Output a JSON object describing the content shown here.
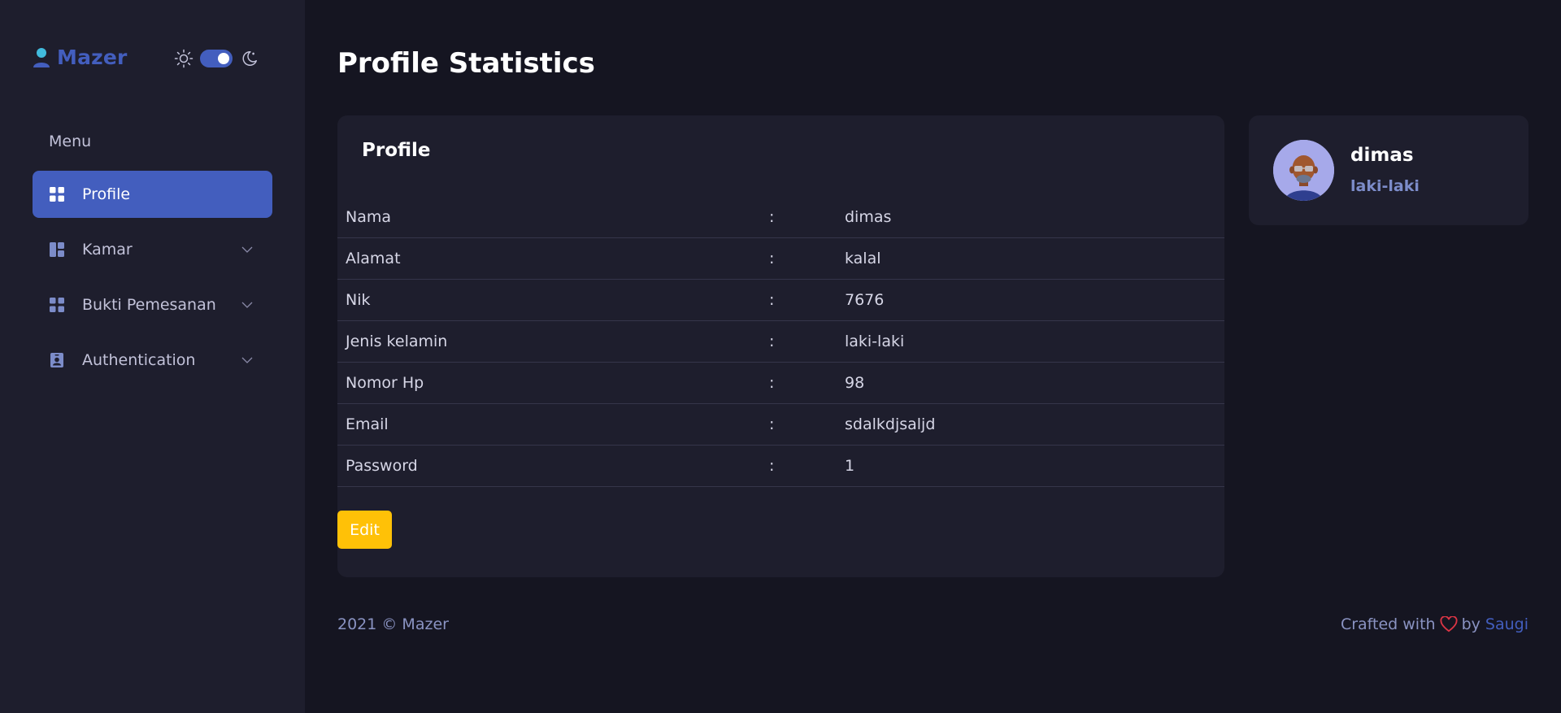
{
  "sidebar": {
    "brand": "Mazer",
    "menu_title": "Menu",
    "items": [
      {
        "label": "Profile",
        "icon": "grid-icon",
        "active": true
      },
      {
        "label": "Kamar",
        "icon": "layout-icon",
        "has_submenu": true
      },
      {
        "label": "Bukti Pemesanan",
        "icon": "grid-icon",
        "has_submenu": true
      },
      {
        "label": "Authentication",
        "icon": "person-badge-icon",
        "has_submenu": true
      }
    ],
    "theme_toggle": {
      "state": "dark"
    }
  },
  "main": {
    "page_title": "Profile Statistics",
    "profile_card": {
      "title": "Profile",
      "rows": [
        {
          "label": "Nama",
          "sep": ":",
          "value": "dimas"
        },
        {
          "label": "Alamat",
          "sep": ":",
          "value": "kalal"
        },
        {
          "label": "Nik",
          "sep": ":",
          "value": "7676"
        },
        {
          "label": "Jenis kelamin",
          "sep": ":",
          "value": "laki-laki"
        },
        {
          "label": "Nomor Hp",
          "sep": ":",
          "value": "98"
        },
        {
          "label": "Email",
          "sep": ":",
          "value": "sdalkdjsaljd"
        },
        {
          "label": "Password",
          "sep": ":",
          "value": "1"
        }
      ],
      "edit_label": "Edit"
    },
    "user_card": {
      "name": "dimas",
      "gender": "laki-laki"
    }
  },
  "footer": {
    "left": "2021 © Mazer",
    "crafted": "Crafted with",
    "by": "by",
    "author": "Saugi"
  },
  "colors": {
    "primary": "#435ebe",
    "warning": "#ffc107",
    "heart": "#dc3545"
  }
}
